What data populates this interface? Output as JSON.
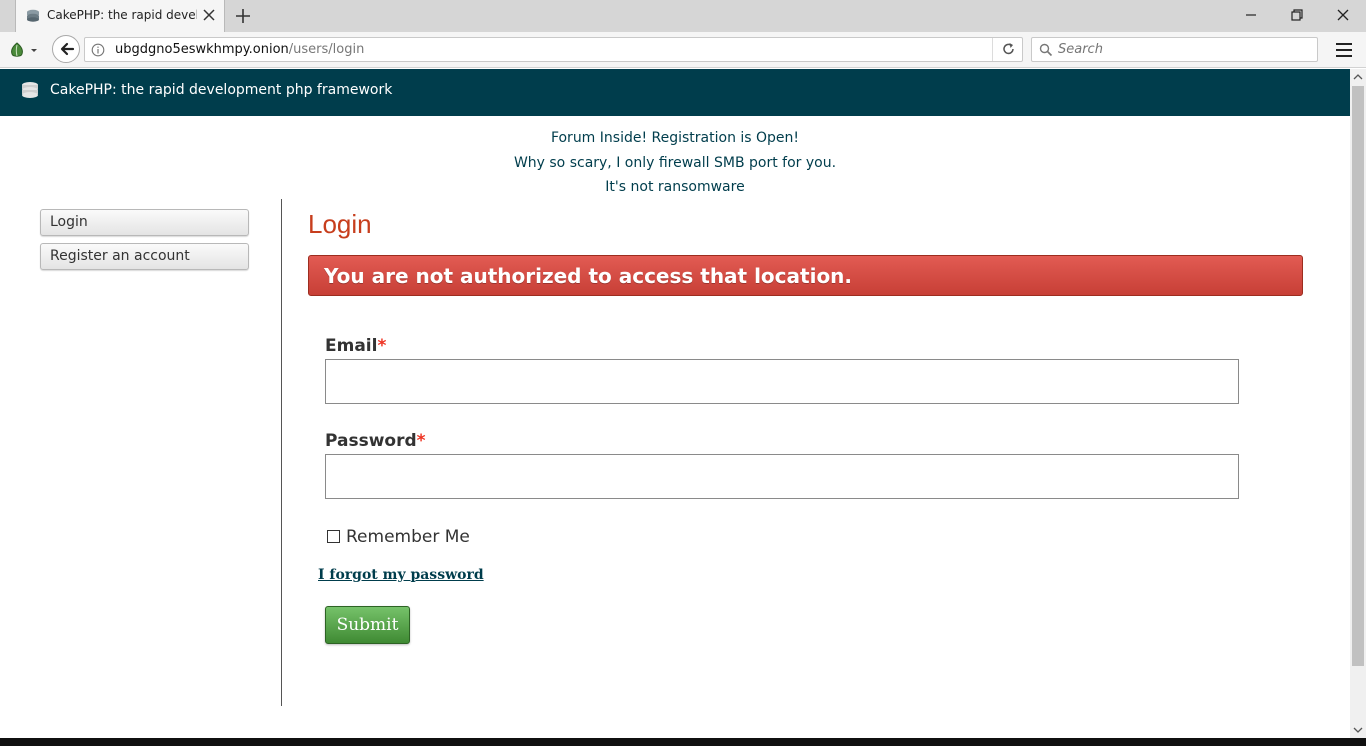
{
  "browser": {
    "tab_title": "CakePHP: the rapid devel...",
    "url_host": "ubgdgno5eswkhmpy.onion",
    "url_path": "/users/login",
    "search_placeholder": "Search"
  },
  "header": {
    "site_title": "CakePHP: the rapid development php framework"
  },
  "banner": {
    "lines": [
      "Forum Inside! Registration is Open!",
      "Why so scary, I only firewall SMB port for you.",
      "It's not ransomware"
    ]
  },
  "sidebar": {
    "items": [
      {
        "label": "Login"
      },
      {
        "label": "Register an account"
      }
    ]
  },
  "main": {
    "title": "Login",
    "flash_message": "You are not authorized to access that location.",
    "email_label": "Email",
    "password_label": "Password",
    "required_marker": "*",
    "remember_label": "Remember Me",
    "forgot_link": "I forgot my password",
    "submit_label": "Submit",
    "email_value": "",
    "password_value": ""
  },
  "colors": {
    "header_bg": "#003d4c",
    "title_red": "#c73e1d",
    "flash_red": "#d34b43",
    "submit_green": "#4a9a3e"
  }
}
